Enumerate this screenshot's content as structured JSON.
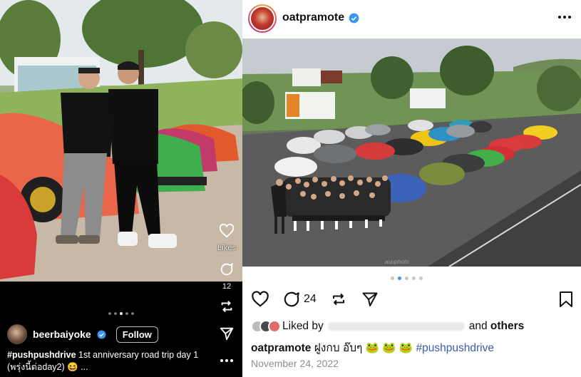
{
  "left_post": {
    "username": "beerbaiyoke",
    "follow_label": "Follow",
    "likes_label": "Likes",
    "comments_count": "12",
    "caption_hashtag": "#pushpushdrive",
    "caption_text": " 1st anniversary road trip day 1 (พรุ่งนี้ต่อday2) 😆 ...",
    "carousel_dots": 5,
    "carousel_active": 2
  },
  "right_post": {
    "username": "oatpramote",
    "watermark": "auuphoto",
    "comment_count": "24",
    "liked_by_prefix": "Liked by",
    "liked_by_suffix": "and",
    "liked_by_others": "others",
    "caption_username": "oatpramote",
    "caption_text": " ฝูงกบ อ๊บๆ 🐸 🐸 🐸 ",
    "caption_hashtag": "#pushpushdrive",
    "date": "November 24, 2022",
    "carousel_dots": 5,
    "carousel_active": 1
  },
  "colors": {
    "verified": "#3897f0",
    "hashtag": "#3b5ea8",
    "date": "#8e8e8e"
  },
  "icons": {
    "left": [
      "heart-icon",
      "comment-icon",
      "repost-icon",
      "send-icon",
      "more-icon"
    ],
    "right": [
      "verified-icon",
      "more-icon",
      "heart-icon",
      "comment-icon",
      "repost-icon",
      "send-icon",
      "bookmark-icon"
    ]
  }
}
